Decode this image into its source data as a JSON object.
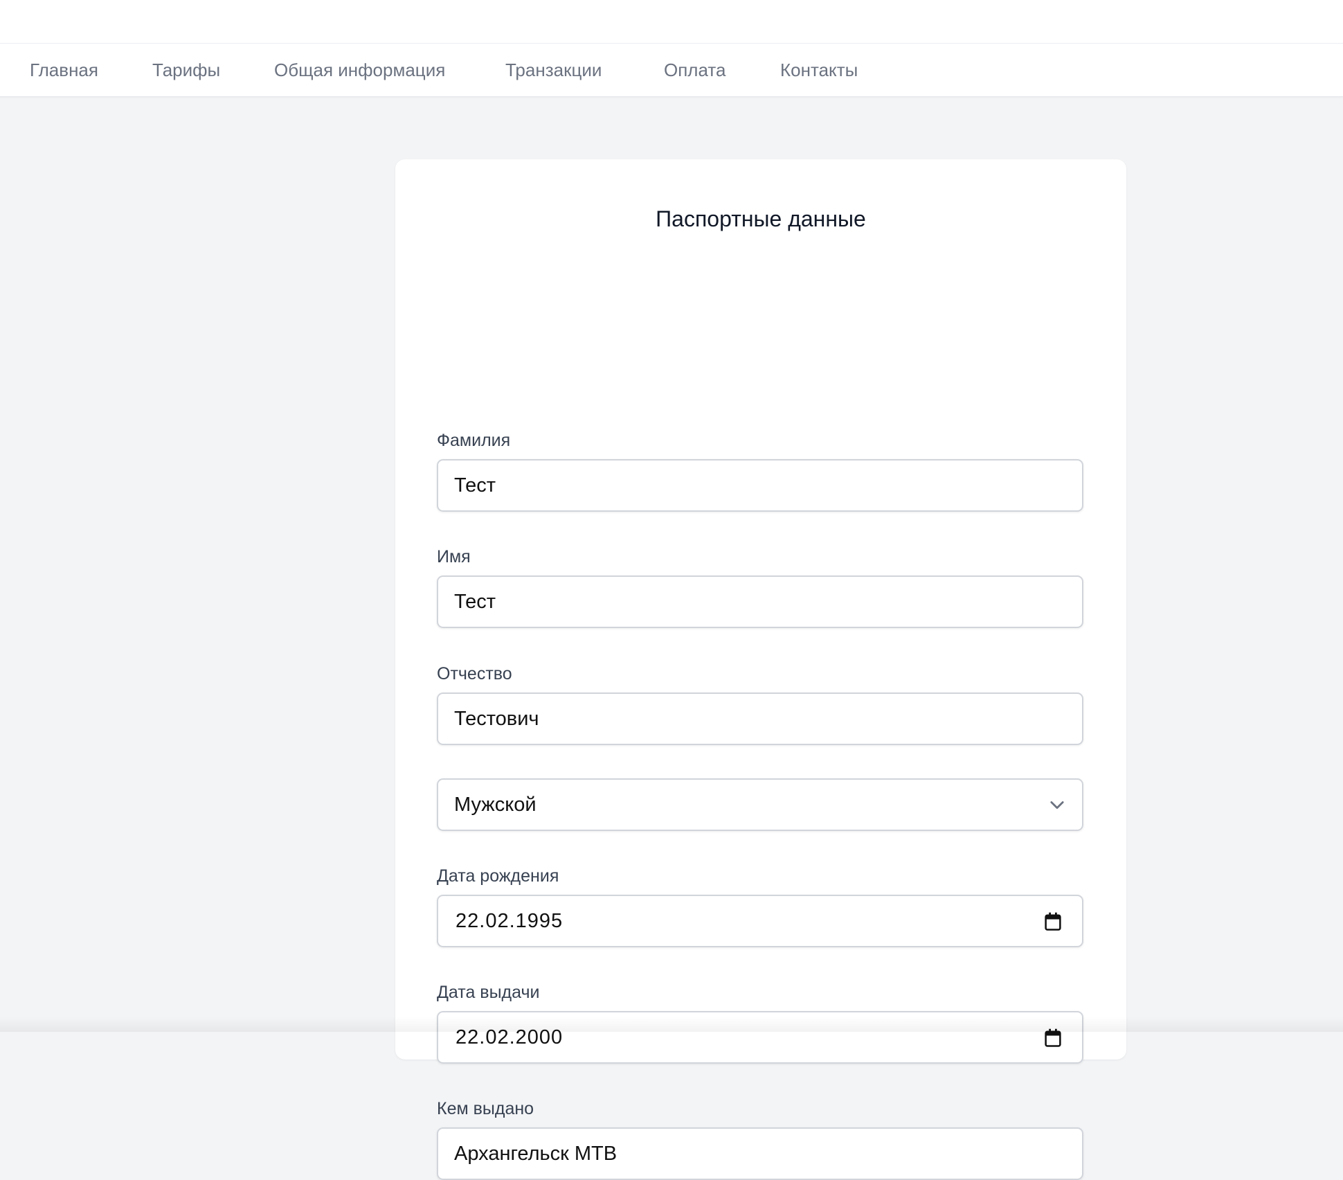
{
  "nav": {
    "items": [
      {
        "label": "Главная"
      },
      {
        "label": "Тарифы"
      },
      {
        "label": "Общая информация"
      },
      {
        "label": "Транзакции"
      },
      {
        "label": "Оплата"
      },
      {
        "label": "Контакты"
      }
    ]
  },
  "form": {
    "title": "Паспортные данные",
    "last_name": {
      "label": "Фамилия",
      "value": "Тест"
    },
    "first_name": {
      "label": "Имя",
      "value": "Тест"
    },
    "patronymic": {
      "label": "Отчество",
      "value": "Тестович"
    },
    "gender": {
      "value": "Мужской",
      "icon": "chevron-down-icon"
    },
    "birth_date": {
      "label": "Дата рождения",
      "value": "22.02.1995",
      "icon": "calendar-icon"
    },
    "issue_date": {
      "label": "Дата выдачи",
      "value": "22.02.2000",
      "icon": "calendar-icon"
    },
    "issued_by": {
      "label": "Кем выдано",
      "value": "Архангельск МТВ"
    }
  },
  "colors": {
    "background": "#f3f4f6",
    "nav_text": "#6b7280",
    "label_text": "#374151",
    "title_text": "#111827",
    "input_border": "#d1d5db"
  }
}
